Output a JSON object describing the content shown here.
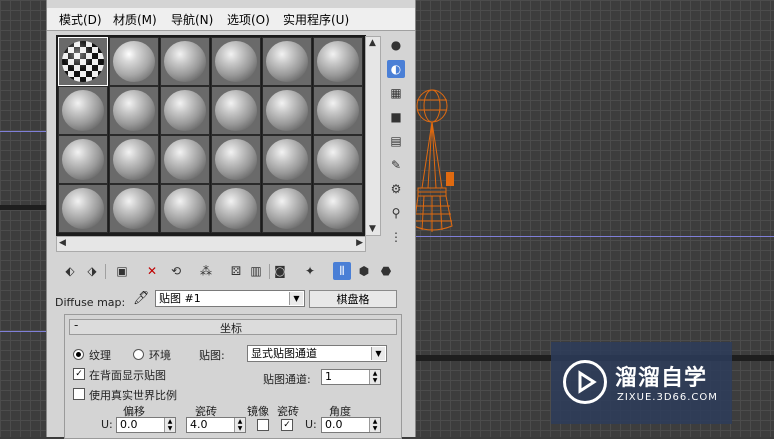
{
  "menu": {
    "items": [
      {
        "label": "模式(D)"
      },
      {
        "label": "材质(M)"
      },
      {
        "label": "导航(N)"
      },
      {
        "label": "选项(O)"
      },
      {
        "label": "实用程序(U)"
      }
    ]
  },
  "diffuse": {
    "label": "Diffuse map:",
    "map_name": "贴图 #1",
    "map_type": "棋盘格"
  },
  "coords": {
    "title": "坐标",
    "texture_label": "纹理",
    "environ_label": "环境",
    "mapping_label": "贴图:",
    "mapping_value": "显式贴图通道",
    "show_back_label": "在背面显示贴图",
    "channel_label": "贴图通道:",
    "channel_value": "1",
    "real_world_label": "使用真实世界比例",
    "offset_label": "偏移",
    "tiling_label": "瓷砖",
    "mirror_label": "镜像",
    "tile_label": "瓷砖",
    "angle_label": "角度",
    "u_label": "U:",
    "u_offset": "0.0",
    "u_tiling": "4.0",
    "u_angle": "0.0",
    "u_mirror": false,
    "u_tile": true,
    "texture_selected": true,
    "show_back": true,
    "real_world": false
  },
  "watermark": {
    "brand": "溜溜自学",
    "url": "ZIXUE.3D66.COM"
  },
  "colors": {
    "accent": "#4a7fd6",
    "model_wire": "#e06a10"
  }
}
